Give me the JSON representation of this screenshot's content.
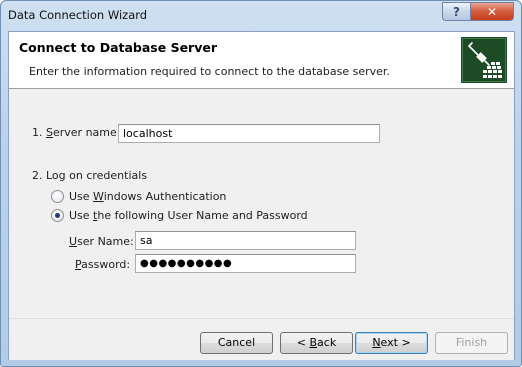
{
  "window": {
    "title": "Data Connection Wizard",
    "help_glyph": "?",
    "close_glyph": "✕"
  },
  "header": {
    "title": "Connect to Database Server",
    "subtitle": "Enter the information required to connect to the database server.",
    "icon": "database-connection-icon"
  },
  "server": {
    "label_prefix": "1. ",
    "label_hotkey": "S",
    "label_rest": "erver name:",
    "value": "localhost"
  },
  "credentials": {
    "heading": "2. Log on credentials",
    "options": [
      {
        "pre": "Use ",
        "hotkey": "W",
        "post": "indows Authentication",
        "selected": false
      },
      {
        "pre": "Use ",
        "hotkey": "t",
        "post": "he following User Name and Password",
        "selected": true
      }
    ],
    "username": {
      "hotkey": "U",
      "rest": "ser Name:",
      "value": "sa"
    },
    "password": {
      "hotkey": "P",
      "rest": "assword:",
      "value": "●●●●●●●●●●"
    }
  },
  "buttons": {
    "cancel": "Cancel",
    "back_pre": "< ",
    "back_hotkey": "B",
    "back_post": "ack",
    "next_hotkey": "N",
    "next_post": "ext >",
    "finish": "Finish"
  },
  "colors": {
    "logo_bg": "#1c4b26",
    "default_button_border": "#3c7fb1",
    "close_button": "#c53c1c"
  }
}
